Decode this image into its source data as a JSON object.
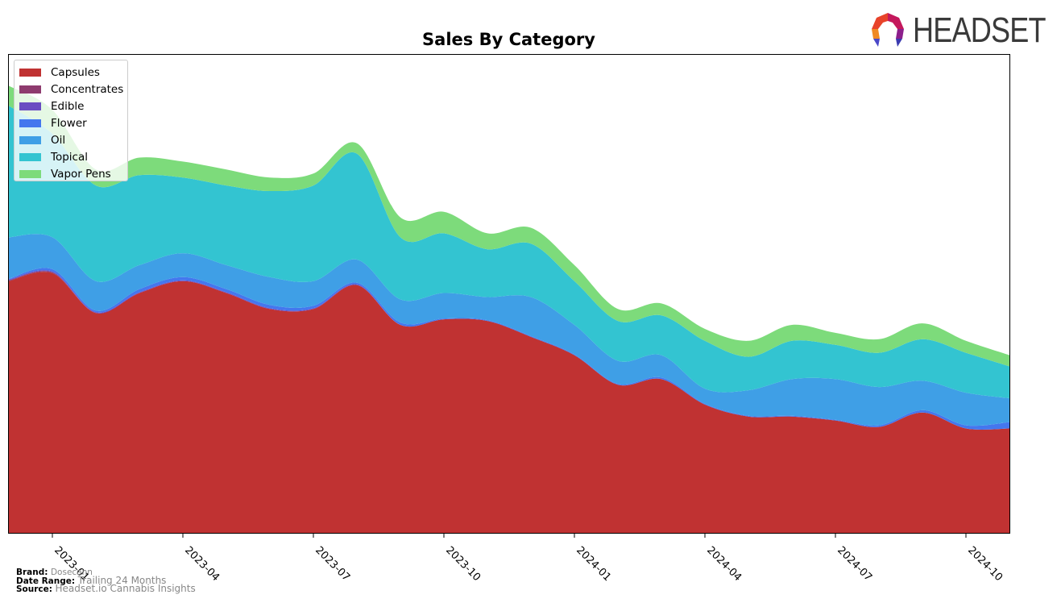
{
  "header": {
    "logo_text": "HEADSET",
    "logo_icon": "headset-hexagon-logo-icon"
  },
  "footer": {
    "brand_label": "Brand:",
    "brand_value": "Dosecann",
    "date_range_label": "Date Range:",
    "date_range_value": "Trailing 24 Months",
    "source_label": "Source:",
    "source_value": "Headset.io Cannabis Insights"
  },
  "chart_data": {
    "type": "area",
    "stacked": true,
    "smoothed": true,
    "title": "Sales By Category",
    "xlabel": "",
    "ylabel": "",
    "y_units": "relative (unlabeled axis)",
    "y_axis_labels_shown": false,
    "ylim": [
      0,
      600
    ],
    "grid": false,
    "legend_position": "top-left",
    "x": [
      "2022-12",
      "2023-01",
      "2023-02",
      "2023-03",
      "2023-04",
      "2023-05",
      "2023-06",
      "2023-07",
      "2023-08",
      "2023-09",
      "2023-10",
      "2023-11",
      "2023-12",
      "2024-01",
      "2024-02",
      "2024-03",
      "2024-04",
      "2024-05",
      "2024-06",
      "2024-07",
      "2024-08",
      "2024-09",
      "2024-10",
      "2024-11"
    ],
    "x_tick_labels": [
      "2023-01",
      "2023-04",
      "2023-07",
      "2023-10",
      "2024-01",
      "2024-04",
      "2024-07",
      "2024-10"
    ],
    "series": [
      {
        "name": "Capsules",
        "color": "#c03232",
        "values": [
          316,
          326,
          276,
          301,
          316,
          301,
          281,
          281,
          311,
          261,
          268,
          266,
          246,
          223,
          186,
          193,
          161,
          146,
          146,
          141,
          133,
          151,
          131,
          131
        ]
      },
      {
        "name": "Concentrates",
        "color": "#8e3b6e",
        "values": [
          1,
          1,
          0,
          0,
          0,
          0,
          0,
          0,
          0,
          0,
          0,
          0,
          0,
          0,
          0,
          0,
          0,
          0,
          0,
          0,
          0,
          0,
          0,
          0
        ]
      },
      {
        "name": "Edible",
        "color": "#6a4cc2",
        "values": [
          1,
          1,
          1,
          1,
          1,
          1,
          1,
          1,
          1,
          0,
          0,
          0,
          0,
          0,
          0,
          0,
          0,
          0,
          0,
          0,
          0,
          0,
          0,
          0
        ]
      },
      {
        "name": "Flower",
        "color": "#4477ee",
        "values": [
          1,
          3,
          2,
          4,
          4,
          4,
          4,
          3,
          2,
          3,
          1,
          1,
          1,
          1,
          1,
          2,
          1,
          1,
          1,
          1,
          2,
          3,
          4,
          8
        ]
      },
      {
        "name": "Oil",
        "color": "#3f9fe6",
        "values": [
          52,
          40,
          37,
          30,
          30,
          30,
          35,
          31,
          29,
          29,
          32,
          29,
          49,
          37,
          29,
          28,
          19,
          32,
          46,
          51,
          48,
          37,
          41,
          30
        ]
      },
      {
        "name": "Topical",
        "color": "#33c4d1",
        "values": [
          165,
          130,
          120,
          113,
          95,
          100,
          108,
          120,
          133,
          78,
          75,
          60,
          67,
          55,
          50,
          50,
          60,
          42,
          48,
          43,
          43,
          52,
          50,
          40
        ]
      },
      {
        "name": "Vapor Pens",
        "color": "#7ddb7b",
        "values": [
          25,
          30,
          20,
          22,
          20,
          20,
          17,
          15,
          13,
          25,
          27,
          20,
          20,
          20,
          15,
          15,
          15,
          20,
          20,
          15,
          17,
          20,
          15,
          14
        ]
      }
    ]
  }
}
